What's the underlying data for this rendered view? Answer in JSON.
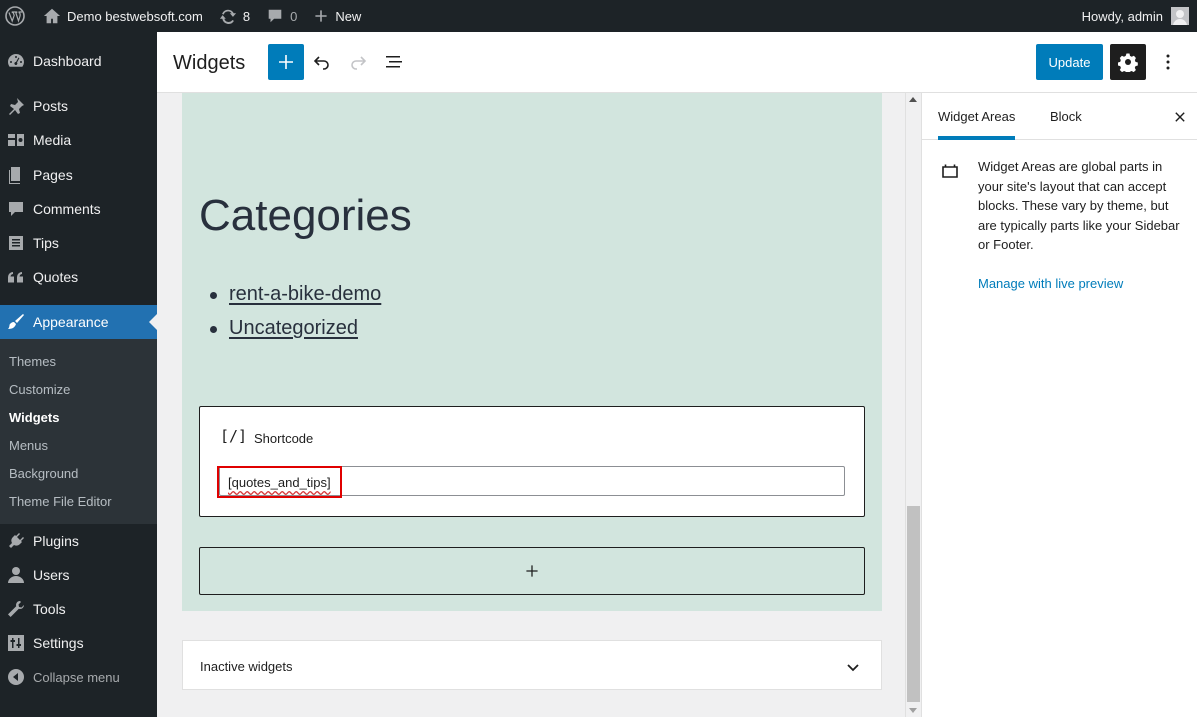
{
  "admin_bar": {
    "site_name": "Demo bestwebsoft.com",
    "updates_count": "8",
    "comments_count": "0",
    "new_label": "New",
    "howdy": "Howdy, admin"
  },
  "menu": {
    "dashboard": "Dashboard",
    "posts": "Posts",
    "media": "Media",
    "pages": "Pages",
    "comments": "Comments",
    "tips": "Tips",
    "quotes": "Quotes",
    "appearance": "Appearance",
    "plugins": "Plugins",
    "users": "Users",
    "tools": "Tools",
    "settings": "Settings",
    "collapse": "Collapse menu"
  },
  "submenu": {
    "themes": "Themes",
    "customize": "Customize",
    "widgets": "Widgets",
    "menus": "Menus",
    "background": "Background",
    "theme_file_editor": "Theme File Editor"
  },
  "editor": {
    "title": "Widgets",
    "update_label": "Update"
  },
  "canvas": {
    "heading": "Categories",
    "categories": [
      "rent-a-bike-demo",
      "Uncategorized"
    ],
    "shortcode_label": "Shortcode",
    "shortcode_icon": "[/]",
    "shortcode_value": "[quotes_and_tips]",
    "add_block": "+",
    "inactive_label": "Inactive widgets"
  },
  "sidebar": {
    "tab_widget_areas": "Widget Areas",
    "tab_block": "Block",
    "description": "Widget Areas are global parts in your site's layout that can accept blocks. These vary by theme, but are typically parts like your Sidebar or Footer.",
    "manage_link": "Manage with live preview"
  },
  "colors": {
    "admin_dark": "#1d2327",
    "accent": "#007cba",
    "current_menu": "#2271b1",
    "widget_area_bg": "#d2e5de",
    "highlight": "#e00000"
  }
}
